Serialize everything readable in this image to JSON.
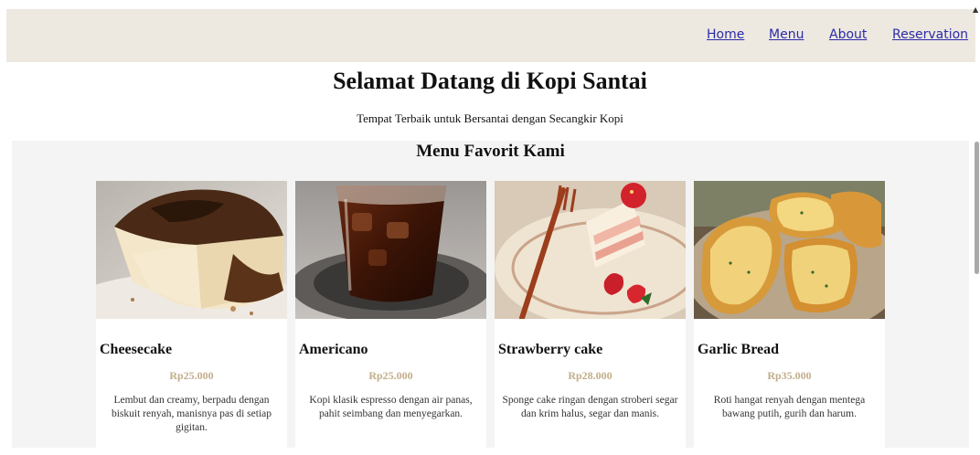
{
  "nav": {
    "items": [
      {
        "label": "Home"
      },
      {
        "label": "Menu"
      },
      {
        "label": "About"
      },
      {
        "label": "Reservation"
      }
    ]
  },
  "hero": {
    "title": "Selamat Datang di Kopi Santai",
    "subtitle": "Tempat Terbaik untuk Bersantai dengan Secangkir Kopi"
  },
  "menu": {
    "heading": "Menu Favorit Kami",
    "items": [
      {
        "name": "Cheesecake",
        "price": "Rp25.000",
        "description": "Lembut dan creamy, berpadu dengan biskuit renyah, manisnya pas di setiap gigitan.",
        "image": "cheesecake-photo"
      },
      {
        "name": "Americano",
        "price": "Rp25.000",
        "description": "Kopi klasik espresso dengan air panas, pahit seimbang dan menyegarkan.",
        "image": "iced-americano-photo"
      },
      {
        "name": "Strawberry cake",
        "price": "Rp28.000",
        "description": "Sponge cake ringan dengan stroberi segar dan krim halus, segar dan manis.",
        "image": "strawberry-cake-photo"
      },
      {
        "name": "Garlic Bread",
        "price": "Rp35.000",
        "description": "Roti hangat renyah dengan mentega bawang putih, gurih dan harum.",
        "image": "garlic-bread-photo"
      }
    ]
  },
  "colors": {
    "navbar_bg": "#ede9e1",
    "link": "#2c2ca8",
    "price": "#c2ad8a",
    "section_bg": "#f4f4f4"
  }
}
